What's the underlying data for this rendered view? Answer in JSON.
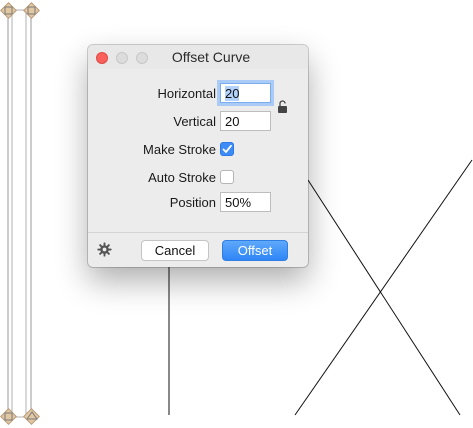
{
  "dialog": {
    "title": "Offset Curve",
    "fields": {
      "horizontal": {
        "label": "Horizontal",
        "value": "20"
      },
      "vertical": {
        "label": "Vertical",
        "value": "20"
      },
      "position": {
        "label": "Position",
        "value": "50%"
      }
    },
    "checkboxes": {
      "make_stroke": {
        "label": "Make Stroke",
        "checked": true
      },
      "auto_stroke": {
        "label": "Auto Stroke",
        "checked": false
      }
    },
    "buttons": {
      "cancel": "Cancel",
      "offset": "Offset"
    },
    "icons": {
      "lock": "unlock-icon",
      "settings": "gear-icon"
    }
  },
  "colors": {
    "accent": "#2f85f6",
    "close_button": "#fc605c",
    "node_handle": "#e2c7a3"
  }
}
